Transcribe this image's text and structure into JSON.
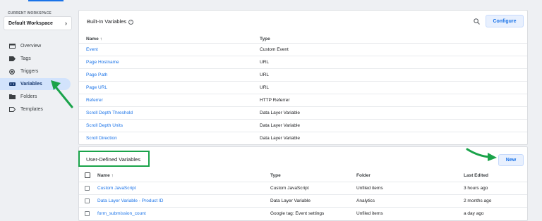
{
  "workspace": {
    "label": "CURRENT WORKSPACE",
    "name": "Default Workspace"
  },
  "sidebar": {
    "items": [
      {
        "label": "Overview",
        "icon": "overview-icon",
        "active": false
      },
      {
        "label": "Tags",
        "icon": "tag-icon",
        "active": false
      },
      {
        "label": "Triggers",
        "icon": "trigger-icon",
        "active": false
      },
      {
        "label": "Variables",
        "icon": "variables-icon",
        "active": true
      },
      {
        "label": "Folders",
        "icon": "folder-icon",
        "active": false
      },
      {
        "label": "Templates",
        "icon": "template-icon",
        "active": false
      }
    ]
  },
  "builtin": {
    "title": "Built-In Variables",
    "configure_label": "Configure",
    "headers": {
      "name": "Name ↑",
      "type": "Type"
    },
    "rows": [
      {
        "name": "Event",
        "type": "Custom Event"
      },
      {
        "name": "Page Hostname",
        "type": "URL"
      },
      {
        "name": "Page Path",
        "type": "URL"
      },
      {
        "name": "Page URL",
        "type": "URL"
      },
      {
        "name": "Referrer",
        "type": "HTTP Referrer"
      },
      {
        "name": "Scroll Depth Threshold",
        "type": "Data Layer Variable"
      },
      {
        "name": "Scroll Depth Units",
        "type": "Data Layer Variable"
      },
      {
        "name": "Scroll Direction",
        "type": "Data Layer Variable"
      }
    ]
  },
  "userdefined": {
    "title": "User-Defined Variables",
    "new_label": "New",
    "headers": {
      "name": "Name ↑",
      "type": "Type",
      "folder": "Folder",
      "edited": "Last Edited"
    },
    "rows": [
      {
        "name": "Custom JavaScript",
        "type": "Custom JavaScript",
        "folder": "Unfiled items",
        "edited": "3 hours ago"
      },
      {
        "name": "Data Layer Variable - Product ID",
        "type": "Data Layer Variable",
        "folder": "Analytics",
        "edited": "2 months ago"
      },
      {
        "name": "form_submission_count",
        "type": "Google tag: Event settings",
        "folder": "Unfiled items",
        "edited": "a day ago"
      }
    ]
  },
  "colors": {
    "accent": "#1a73e8",
    "highlight": "#1aa34a",
    "active_nav": "#d2e3fc"
  }
}
